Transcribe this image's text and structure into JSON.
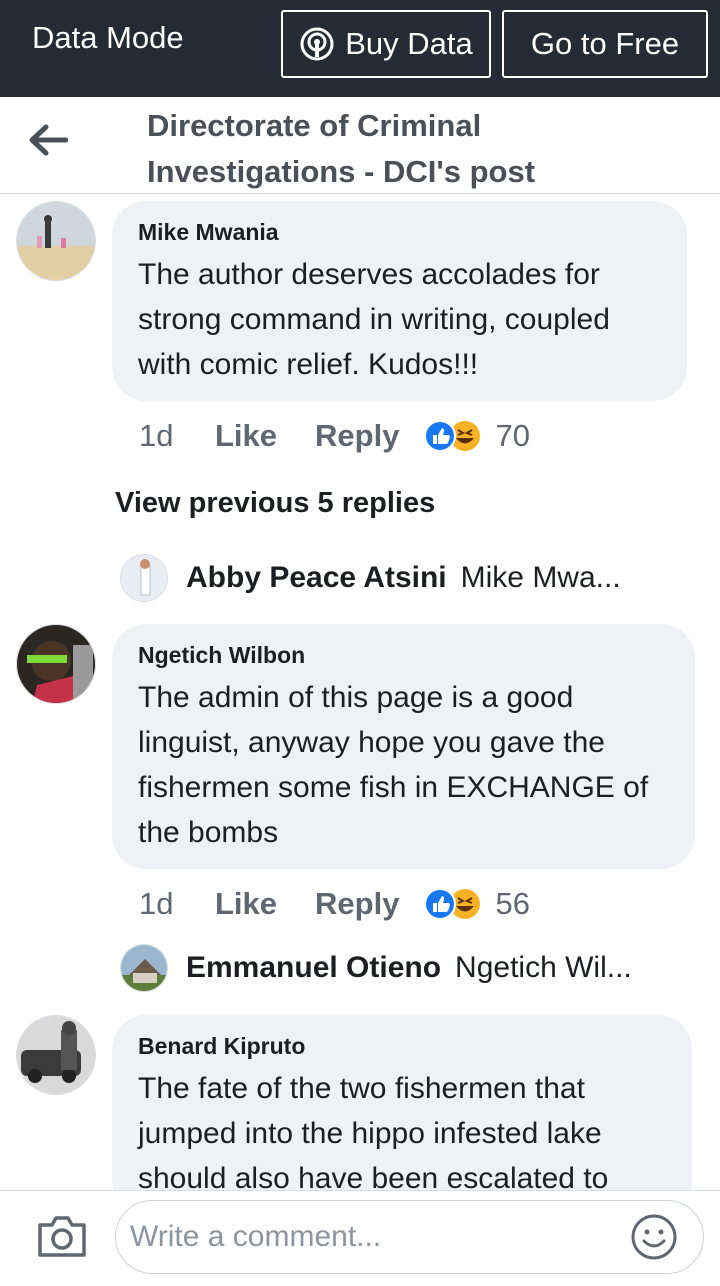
{
  "databar": {
    "mode_label": "Data Mode",
    "buy_label": "Buy Data",
    "free_label": "Go to Free"
  },
  "header": {
    "title": "Directorate of Criminal Investigations - DCI's post"
  },
  "comments": [
    {
      "author": "Mike Mwania",
      "text": "The author deserves accolades for strong command in writing, coupled with comic relief. Kudos!!!",
      "time": "1d",
      "like_label": "Like",
      "reply_label": "Reply",
      "reactions": "70",
      "reaction_icons": [
        "like-icon",
        "haha-icon"
      ]
    },
    {
      "author": "Ngetich Wilbon",
      "text": "The admin of this page is a good linguist, anyway hope you gave the fishermen some fish in EXCHANGE of the bombs",
      "time": "1d",
      "like_label": "Like",
      "reply_label": "Reply",
      "reactions": "56",
      "reaction_icons": [
        "like-icon",
        "haha-icon"
      ]
    },
    {
      "author": "Benard Kipruto",
      "text": "The fate of the two fishermen that jumped into the hippo infested lake should also have been escalated to"
    }
  ],
  "view_previous": "View previous 5 replies",
  "replies": [
    {
      "author": "Abby Peace Atsini",
      "snippet": "Mike Mwa..."
    },
    {
      "author": "Emmanuel Otieno",
      "snippet": "Ngetich Wil..."
    }
  ],
  "composer": {
    "placeholder": "Write a comment..."
  },
  "colors": {
    "top_bar": "#252b35",
    "bubble": "#eff1f4",
    "like_blue": "#1877f2",
    "haha_yellow": "#f7b125"
  }
}
